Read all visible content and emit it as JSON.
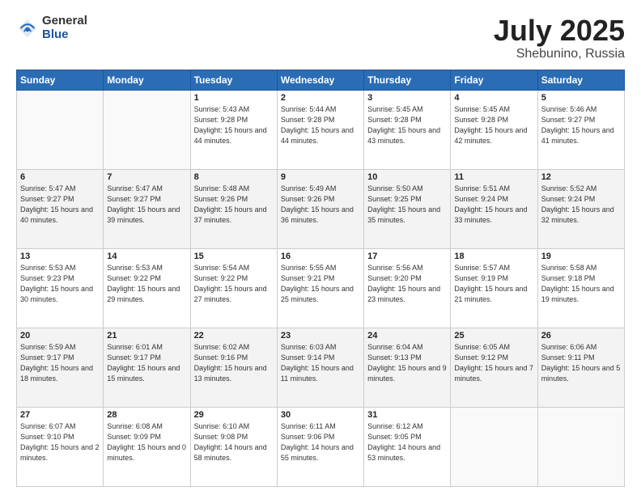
{
  "header": {
    "logo_general": "General",
    "logo_blue": "Blue",
    "title": "July 2025",
    "location": "Shebunino, Russia"
  },
  "weekdays": [
    "Sunday",
    "Monday",
    "Tuesday",
    "Wednesday",
    "Thursday",
    "Friday",
    "Saturday"
  ],
  "weeks": [
    [
      {
        "day": "",
        "info": ""
      },
      {
        "day": "",
        "info": ""
      },
      {
        "day": "1",
        "info": "Sunrise: 5:43 AM\nSunset: 9:28 PM\nDaylight: 15 hours and 44 minutes."
      },
      {
        "day": "2",
        "info": "Sunrise: 5:44 AM\nSunset: 9:28 PM\nDaylight: 15 hours and 44 minutes."
      },
      {
        "day": "3",
        "info": "Sunrise: 5:45 AM\nSunset: 9:28 PM\nDaylight: 15 hours and 43 minutes."
      },
      {
        "day": "4",
        "info": "Sunrise: 5:45 AM\nSunset: 9:28 PM\nDaylight: 15 hours and 42 minutes."
      },
      {
        "day": "5",
        "info": "Sunrise: 5:46 AM\nSunset: 9:27 PM\nDaylight: 15 hours and 41 minutes."
      }
    ],
    [
      {
        "day": "6",
        "info": "Sunrise: 5:47 AM\nSunset: 9:27 PM\nDaylight: 15 hours and 40 minutes."
      },
      {
        "day": "7",
        "info": "Sunrise: 5:47 AM\nSunset: 9:27 PM\nDaylight: 15 hours and 39 minutes."
      },
      {
        "day": "8",
        "info": "Sunrise: 5:48 AM\nSunset: 9:26 PM\nDaylight: 15 hours and 37 minutes."
      },
      {
        "day": "9",
        "info": "Sunrise: 5:49 AM\nSunset: 9:26 PM\nDaylight: 15 hours and 36 minutes."
      },
      {
        "day": "10",
        "info": "Sunrise: 5:50 AM\nSunset: 9:25 PM\nDaylight: 15 hours and 35 minutes."
      },
      {
        "day": "11",
        "info": "Sunrise: 5:51 AM\nSunset: 9:24 PM\nDaylight: 15 hours and 33 minutes."
      },
      {
        "day": "12",
        "info": "Sunrise: 5:52 AM\nSunset: 9:24 PM\nDaylight: 15 hours and 32 minutes."
      }
    ],
    [
      {
        "day": "13",
        "info": "Sunrise: 5:53 AM\nSunset: 9:23 PM\nDaylight: 15 hours and 30 minutes."
      },
      {
        "day": "14",
        "info": "Sunrise: 5:53 AM\nSunset: 9:22 PM\nDaylight: 15 hours and 29 minutes."
      },
      {
        "day": "15",
        "info": "Sunrise: 5:54 AM\nSunset: 9:22 PM\nDaylight: 15 hours and 27 minutes."
      },
      {
        "day": "16",
        "info": "Sunrise: 5:55 AM\nSunset: 9:21 PM\nDaylight: 15 hours and 25 minutes."
      },
      {
        "day": "17",
        "info": "Sunrise: 5:56 AM\nSunset: 9:20 PM\nDaylight: 15 hours and 23 minutes."
      },
      {
        "day": "18",
        "info": "Sunrise: 5:57 AM\nSunset: 9:19 PM\nDaylight: 15 hours and 21 minutes."
      },
      {
        "day": "19",
        "info": "Sunrise: 5:58 AM\nSunset: 9:18 PM\nDaylight: 15 hours and 19 minutes."
      }
    ],
    [
      {
        "day": "20",
        "info": "Sunrise: 5:59 AM\nSunset: 9:17 PM\nDaylight: 15 hours and 18 minutes."
      },
      {
        "day": "21",
        "info": "Sunrise: 6:01 AM\nSunset: 9:17 PM\nDaylight: 15 hours and 15 minutes."
      },
      {
        "day": "22",
        "info": "Sunrise: 6:02 AM\nSunset: 9:16 PM\nDaylight: 15 hours and 13 minutes."
      },
      {
        "day": "23",
        "info": "Sunrise: 6:03 AM\nSunset: 9:14 PM\nDaylight: 15 hours and 11 minutes."
      },
      {
        "day": "24",
        "info": "Sunrise: 6:04 AM\nSunset: 9:13 PM\nDaylight: 15 hours and 9 minutes."
      },
      {
        "day": "25",
        "info": "Sunrise: 6:05 AM\nSunset: 9:12 PM\nDaylight: 15 hours and 7 minutes."
      },
      {
        "day": "26",
        "info": "Sunrise: 6:06 AM\nSunset: 9:11 PM\nDaylight: 15 hours and 5 minutes."
      }
    ],
    [
      {
        "day": "27",
        "info": "Sunrise: 6:07 AM\nSunset: 9:10 PM\nDaylight: 15 hours and 2 minutes."
      },
      {
        "day": "28",
        "info": "Sunrise: 6:08 AM\nSunset: 9:09 PM\nDaylight: 15 hours and 0 minutes."
      },
      {
        "day": "29",
        "info": "Sunrise: 6:10 AM\nSunset: 9:08 PM\nDaylight: 14 hours and 58 minutes."
      },
      {
        "day": "30",
        "info": "Sunrise: 6:11 AM\nSunset: 9:06 PM\nDaylight: 14 hours and 55 minutes."
      },
      {
        "day": "31",
        "info": "Sunrise: 6:12 AM\nSunset: 9:05 PM\nDaylight: 14 hours and 53 minutes."
      },
      {
        "day": "",
        "info": ""
      },
      {
        "day": "",
        "info": ""
      }
    ]
  ]
}
